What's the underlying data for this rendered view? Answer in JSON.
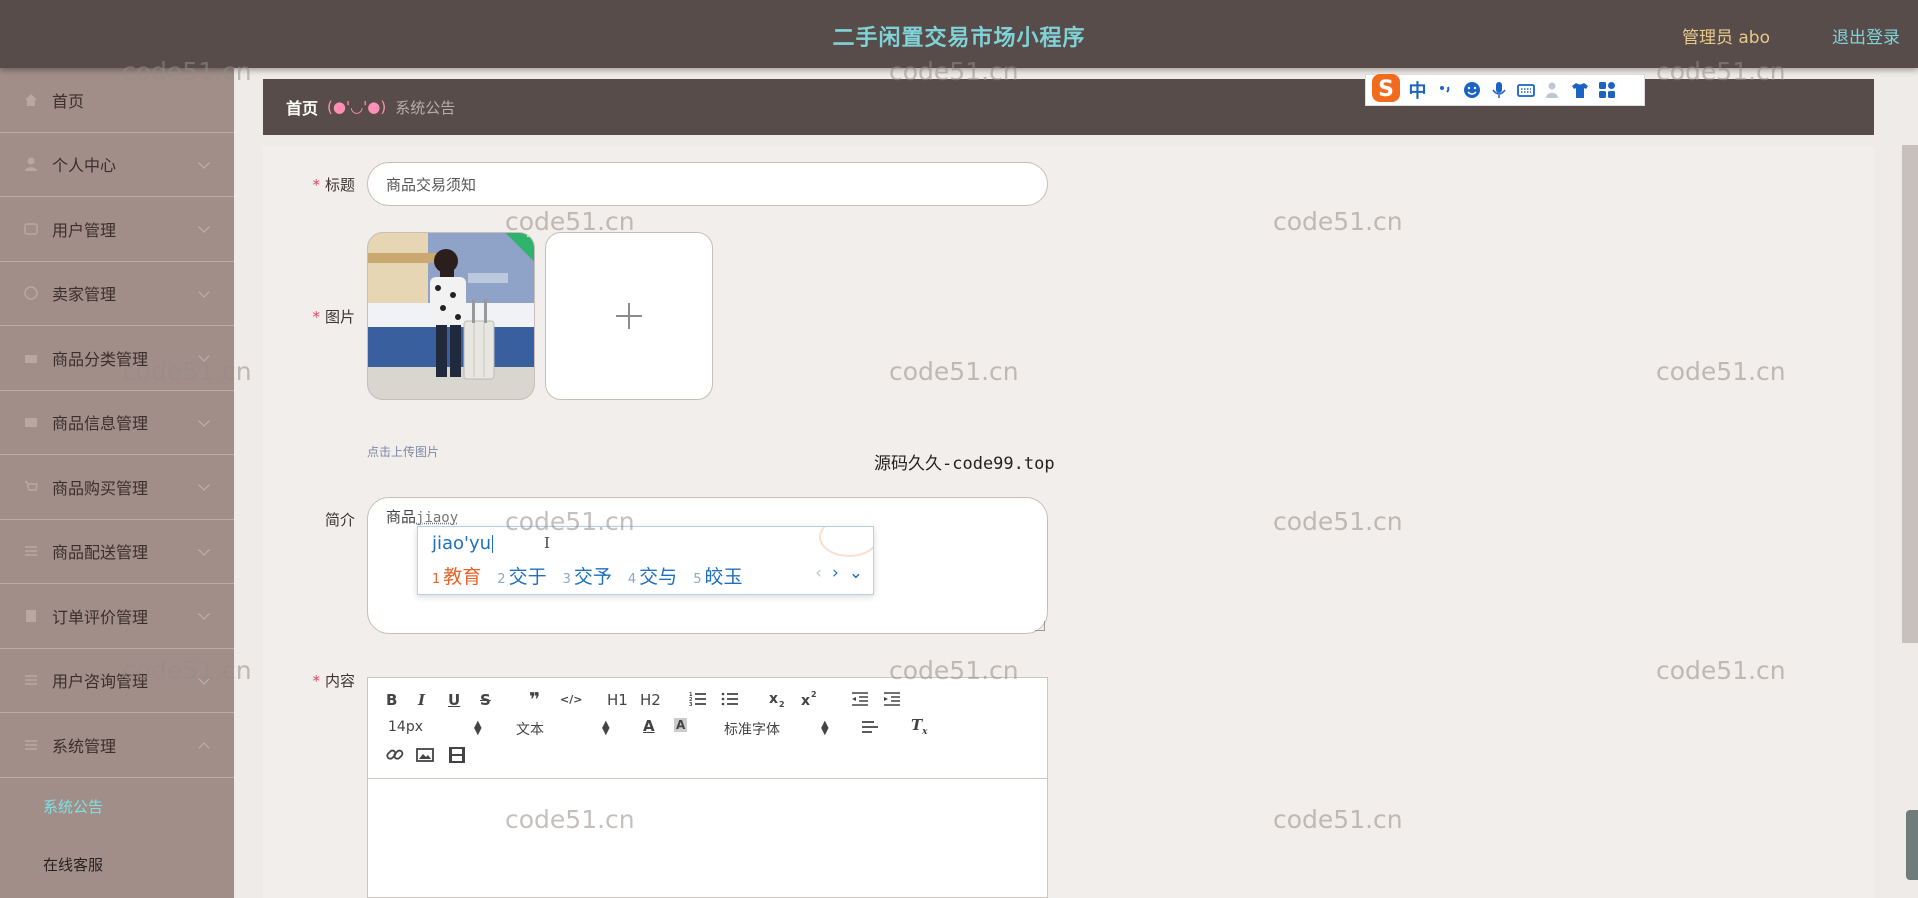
{
  "header": {
    "title": "二手闲置交易市场小程序",
    "admin_label": "管理员 abo",
    "logout_label": "退出登录"
  },
  "sidebar": {
    "items": [
      {
        "label": "首页",
        "icon": "home-icon"
      },
      {
        "label": "个人中心",
        "icon": "user-icon"
      },
      {
        "label": "用户管理",
        "icon": "users-icon"
      },
      {
        "label": "卖家管理",
        "icon": "seller-icon"
      },
      {
        "label": "商品分类管理",
        "icon": "category-icon"
      },
      {
        "label": "商品信息管理",
        "icon": "goods-icon"
      },
      {
        "label": "商品购买管理",
        "icon": "cart-icon"
      },
      {
        "label": "商品配送管理",
        "icon": "delivery-icon"
      },
      {
        "label": "订单评价管理",
        "icon": "review-icon"
      },
      {
        "label": "用户咨询管理",
        "icon": "consult-icon"
      },
      {
        "label": "系统管理",
        "icon": "settings-icon"
      }
    ],
    "sub_items": [
      "系统公告",
      "在线客服"
    ]
  },
  "breadcrumb": {
    "home": "首页",
    "separator": "(●'◡'●)",
    "current": "系统公告"
  },
  "form": {
    "title_label": "标题",
    "title_value": "商品交易须知",
    "image_label": "图片",
    "upload_hint": "点击上传图片",
    "intro_label": "简介",
    "intro_committed": "商品",
    "intro_composing": "jiaoy",
    "content_label": "内容"
  },
  "ime": {
    "mode": "中",
    "pinyin": "jiao'yu",
    "candidates": [
      {
        "num": "1",
        "text": "教育"
      },
      {
        "num": "2",
        "text": "交于"
      },
      {
        "num": "3",
        "text": "交予"
      },
      {
        "num": "4",
        "text": "交与"
      },
      {
        "num": "5",
        "text": "皎玉"
      }
    ]
  },
  "editor": {
    "font_size": "14px",
    "text_style": "文本",
    "font_family": "标准字体",
    "toolbar_buttons": [
      "B",
      "I",
      "U",
      "S",
      "❞",
      "</>",
      "H1",
      "H2"
    ]
  },
  "watermarks": {
    "site": "code51.cn",
    "center": "源码久久-code99.top"
  },
  "colors": {
    "header_bg": "#574c49",
    "title_color": "#7fd3d8",
    "sidebar_bg": "#a18e89",
    "active_sub": "#7fe0e6",
    "required": "#e6455f"
  }
}
